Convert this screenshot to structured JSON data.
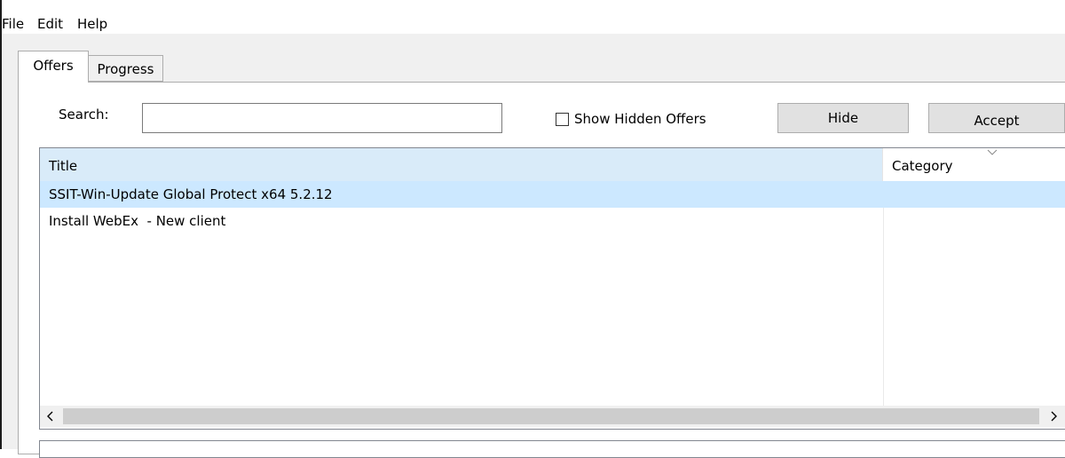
{
  "menu": {
    "file": "File",
    "edit": "Edit",
    "help": "Help"
  },
  "tabs": [
    {
      "label": "Offers",
      "active": true
    },
    {
      "label": "Progress",
      "active": false
    }
  ],
  "search": {
    "label": "Search:",
    "value": "",
    "placeholder": ""
  },
  "show_hidden": {
    "label": "Show Hidden Offers",
    "checked": false
  },
  "buttons": {
    "hide": "Hide",
    "accept": "Accept"
  },
  "list": {
    "columns": [
      "Title",
      "Category"
    ],
    "rows": [
      {
        "title": "SSIT-Win-Update Global Protect x64 5.2.12",
        "category": "",
        "selected": true
      },
      {
        "title": "Install WebEx  - New client",
        "category": "",
        "selected": false
      }
    ]
  },
  "colors": {
    "selected_row": "#cce8ff",
    "header_hover": "#d9ebf9",
    "button_face": "#e1e1e1"
  },
  "icons": {
    "sort": "chevron-down-icon",
    "scroll_left": "chevron-left-icon",
    "scroll_right": "chevron-right-icon"
  }
}
